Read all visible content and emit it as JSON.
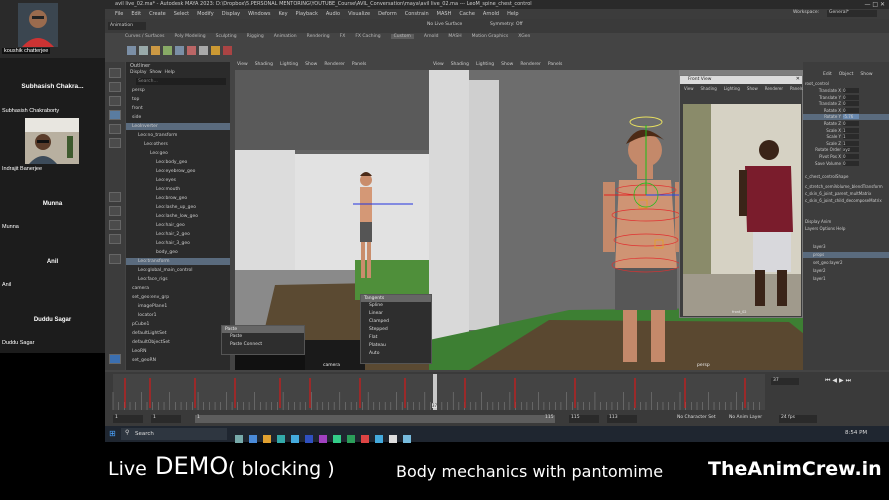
{
  "meeting": {
    "participants": [
      {
        "name": "koushik chatterjee",
        "tile_label": ""
      },
      {
        "name": "Subhasish Chakraborty",
        "tile_label": "Subhasish Chakra..."
      },
      {
        "name": "Indrajit Banerjee",
        "tile_label": ""
      },
      {
        "name": "Munna",
        "tile_label": "Munna"
      },
      {
        "name": "Anil",
        "tile_label": "Anil"
      },
      {
        "name": "Duddu Sagar",
        "tile_label": "Duddu Sagar"
      }
    ]
  },
  "maya": {
    "title": "avil live_02.ma* - Autodesk MAYA 2023: D:\\Dropbox\\5.PERSONAL MENTORING\\YOUTUBE_Course\\AVIL_Conversation\\maya\\avil live_02.ma --- LeoM_spine_chest_control",
    "menus": [
      "File",
      "Edit",
      "Create",
      "Select",
      "Modify",
      "Display",
      "Windows",
      "Key",
      "Playback",
      "Audio",
      "Visualize",
      "Deform",
      "Constrain",
      "MASH",
      "Cache",
      "Arnold",
      "Help"
    ],
    "workspace_label": "Workspace:",
    "workspace_value": "General*",
    "mode_menu": "Animation",
    "no_live_surface": "No Live Surface",
    "symmetry": "Symmetry: Off",
    "shelf_tabs": [
      "Curves / Surfaces",
      "Poly Modeling",
      "Sculpting",
      "Rigging",
      "Animation",
      "Rendering",
      "FX",
      "FX Caching",
      "Custom",
      "Arnold",
      "MASH",
      "Motion Graphics",
      "XGen"
    ],
    "active_shelf": "Custom",
    "outliner": {
      "title": "Outliner",
      "menu": [
        "Display",
        "Show",
        "Help"
      ],
      "search": "Search...",
      "items": [
        "persp",
        "top",
        "front",
        "side",
        "LeoInverter",
        "Leo:no_transform",
        "Leo:others",
        "Leo:geo",
        "Leo:body_geo",
        "Leo:eyebrow_geo",
        "Leo:eyes",
        "Leo:mouth",
        "Leo:brow_geo",
        "Leo:lashe_up_geo",
        "Leo:lashe_low_geo",
        "Leo:hair_geo",
        "Leo:hair_2_geo",
        "Leo:hair_3_geo",
        "body_geo",
        "Leo:transform",
        "Leo:global_main_control",
        "Leo:face_rigs",
        "camera",
        "set_geo:env_grp",
        "imagePlane1",
        "locator1",
        "pCube1",
        "defaultLightSet",
        "defaultObjectSet",
        "LeoRN",
        "set_geoRN"
      ]
    },
    "viewport_menu": [
      "View",
      "Shading",
      "Lighting",
      "Show",
      "Renderer",
      "Panels"
    ],
    "viewport1_label": "camera",
    "viewport2_label": "persp",
    "paste_menu": {
      "title": "Paste",
      "items": [
        "Paste",
        "Paste Connect"
      ]
    },
    "tangents_menu": {
      "title": "Tangents",
      "items": [
        "Spline",
        "Linear",
        "Clamped",
        "Stepped",
        "Flat",
        "Plateau",
        "Auto"
      ]
    },
    "ref_window": {
      "title": "Front View",
      "menu": [
        "View",
        "Shading",
        "Lighting",
        "Show",
        "Renderer",
        "Panels"
      ],
      "label": "front_02"
    },
    "channel_box": {
      "menu": [
        "Edit",
        "Object",
        "Show"
      ],
      "name": "root_control",
      "channels": [
        {
          "label": "Translate X",
          "value": "0"
        },
        {
          "label": "Translate Y",
          "value": "0"
        },
        {
          "label": "Translate Z",
          "value": "0"
        },
        {
          "label": "Rotate X",
          "value": "0"
        },
        {
          "label": "Rotate Y",
          "value": "-5.76"
        },
        {
          "label": "Rotate Z",
          "value": "0"
        },
        {
          "label": "Scale X",
          "value": "1"
        },
        {
          "label": "Scale Y",
          "value": "1"
        },
        {
          "label": "Scale Z",
          "value": "1"
        },
        {
          "label": "Rotate Order",
          "value": "xyz"
        },
        {
          "label": "Pivot Pos X",
          "value": "0"
        },
        {
          "label": "Save Volume",
          "value": "0"
        }
      ],
      "shapes": [
        "c_chest_controlShape"
      ],
      "inputs": [
        "c_stretch_semiVolume_blendTransform",
        "c_skin_6_joint_parent_multMatrix",
        "c_skin_6_joint_child_decomposeMatrix"
      ],
      "layer_menu": [
        "Display",
        "Anim"
      ],
      "layer_submenu": [
        "Layers",
        "Options",
        "Help"
      ],
      "layers": [
        "layer3",
        "props",
        "set_geo:layer2",
        "layer2",
        "layer1"
      ]
    },
    "timeline": {
      "start": "1",
      "end": "115",
      "current": "37",
      "range_start": "1",
      "range_end": "115",
      "range_end2": "113",
      "fps": "24 fps",
      "character_set": "No Character Set",
      "anim_layer": "No Anim Layer"
    },
    "taskbar": {
      "search": "Search",
      "time": "8:54 PM"
    }
  },
  "captions": {
    "live": "Live",
    "demo": "DEMO",
    "blocking": "( blocking )",
    "subtitle": "Body mechanics with pantomime",
    "brand": "TheAnimCrew.in"
  }
}
